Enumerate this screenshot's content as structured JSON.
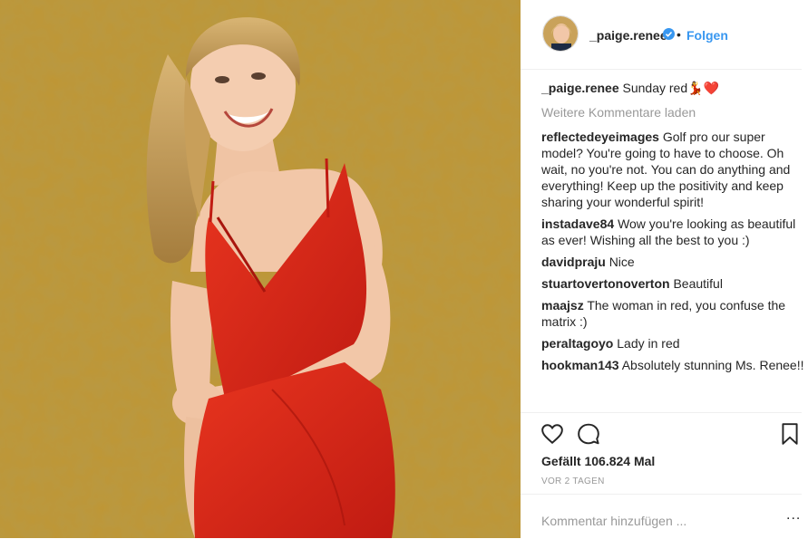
{
  "post": {
    "username": "_paige.renee",
    "separator": "•",
    "follow_label": "Folgen",
    "caption_user": "_paige.renee",
    "caption_text": "Sunday red💃❤️",
    "load_more": "Weitere Kommentare laden",
    "comments": [
      {
        "user": "reflectedeyeimages",
        "text": "Golf pro our super model? You're going to have to choose. Oh wait, no you're not. You can do anything and everything! Keep up the positivity and keep sharing your wonderful spirit!"
      },
      {
        "user": "instadave84",
        "text": "Wow you're looking as beautiful as ever! Wishing all the best to you :)"
      },
      {
        "user": "davidpraju",
        "text": "Nice"
      },
      {
        "user": "stuartovertonoverton",
        "text": "Beautiful"
      },
      {
        "user": "maajsz",
        "text": "The woman in red, you confuse the matrix :)"
      },
      {
        "user": "peraltagoyo",
        "text": "Lady in red"
      },
      {
        "user": "hookman143",
        "text": "Absolutely stunning Ms. Renee!!"
      }
    ],
    "likes": "Gefällt 106.824 Mal",
    "date": "VOR 2 TAGEN",
    "add_comment_placeholder": "Kommentar hinzufügen ...",
    "options_label": "..."
  },
  "icons": [
    "heart-icon",
    "comment-icon",
    "bookmark-icon",
    "verified-badge-icon",
    "options-icon"
  ],
  "colors": {
    "link": "#3897f0",
    "muted": "#999999",
    "wall": "#b8902f",
    "dress": "#d8281c"
  }
}
